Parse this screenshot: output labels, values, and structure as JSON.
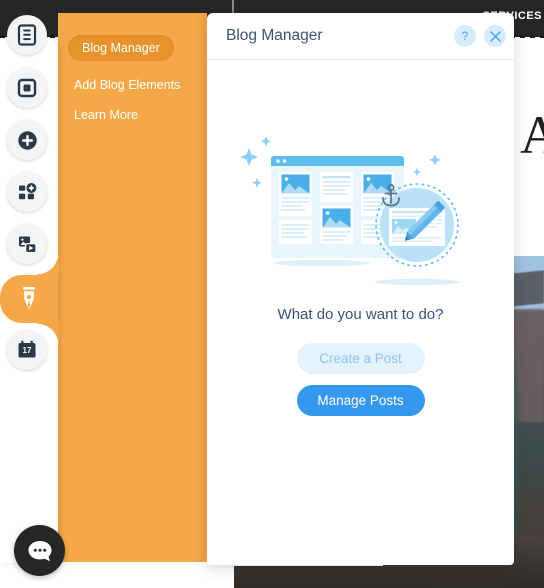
{
  "background_site": {
    "topbar_label": "SERVICES",
    "hero_letter": "A",
    "photo_alt": "building-photo"
  },
  "sidebar": {
    "items": [
      {
        "icon": "pages-icon",
        "name": "pages"
      },
      {
        "icon": "section-icon",
        "name": "section"
      },
      {
        "icon": "plus-circle-icon",
        "name": "add"
      },
      {
        "icon": "apps-add-icon",
        "name": "apps"
      },
      {
        "icon": "media-icon",
        "name": "media"
      },
      {
        "icon": "pen-nib-icon",
        "name": "blog",
        "active": true
      },
      {
        "icon": "calendar-icon",
        "name": "bookings",
        "day": "17"
      }
    ]
  },
  "flyout": {
    "items": [
      {
        "label": "Blog Manager",
        "active": true
      },
      {
        "label": "Add Blog Elements",
        "active": false
      },
      {
        "label": "Learn More",
        "active": false
      }
    ]
  },
  "dialog": {
    "title": "Blog Manager",
    "help_label": "?",
    "close_label": "×",
    "prompt": "What do you want to do?",
    "create_post_label": "Create a Post",
    "manage_posts_label": "Manage Posts"
  },
  "chat": {
    "icon": "chat-bubble-icon"
  },
  "colors": {
    "accent_orange": "#f5a847",
    "accent_orange_dark": "#e8922c",
    "primary_blue": "#3498ee",
    "pale_blue": "#e4f2fd",
    "title_navy": "#3b5472",
    "dark_bar": "#262626"
  }
}
